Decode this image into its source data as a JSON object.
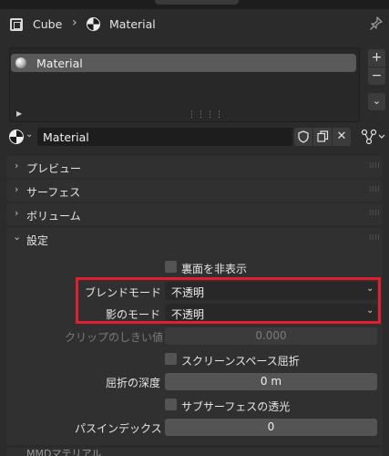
{
  "header": {
    "object_label": "Cube",
    "material_label": "Material"
  },
  "slots": {
    "items": [
      {
        "label": "Material",
        "selected": true
      }
    ],
    "add_label": "+",
    "remove_label": "−",
    "more_label": "⌄"
  },
  "material_selector": {
    "value": "Material"
  },
  "panels": {
    "preview": "プレビュー",
    "surface": "サーフェス",
    "volume": "ボリューム",
    "settings": "設定",
    "mmd": "MMDマテリアル"
  },
  "settings": {
    "backface_culling_label": "裏面を非表示",
    "blend_mode_label": "ブレンドモード",
    "blend_mode_value": "不透明",
    "shadow_mode_label": "影のモード",
    "shadow_mode_value": "不透明",
    "clip_threshold_label": "クリップのしきい値",
    "clip_threshold_value": "0.000",
    "screen_space_refraction_label": "スクリーンスペース屈折",
    "refraction_depth_label": "屈折の深度",
    "refraction_depth_value": "0 m",
    "subsurface_translucency_label": "サブサーフェスの透光",
    "pass_index_label": "パスインデックス",
    "pass_index_value": "0"
  },
  "colors": {
    "background": "#2b2b2b",
    "panel": "#303030",
    "highlight_box": "#e01e2e",
    "field_dark": "#1d1d1d",
    "field_light": "#545454"
  }
}
